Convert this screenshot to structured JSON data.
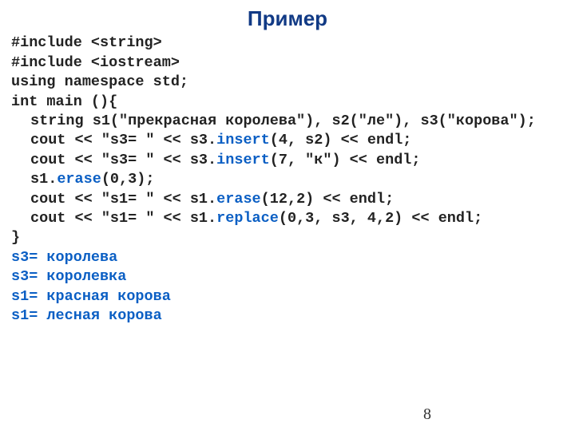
{
  "title": "Пример",
  "page_number": "8",
  "colors": {
    "heading": "#113a85",
    "code_highlight": "#0b5fc4",
    "text": "#222222",
    "background": "#ffffff"
  },
  "code": {
    "inc1": "#include <string>",
    "inc2": "#include <iostream>",
    "ns": "using namespace std;",
    "main": "int main (){",
    "decl": "string s1(\"прекрасная королева\"), s2(\"ле\"), s3(\"корова\");",
    "cout1_a": "cout << \"s3= \" << s3.",
    "cout1_m": "insert",
    "cout1_b": "(4, s2) << endl;",
    "cout2_a": "cout << \"s3= \" << s3.",
    "cout2_m": "insert",
    "cout2_b": "(7, \"к\") << endl;",
    "erase_a": "s1.",
    "erase_m": "erase",
    "erase_b": "(0,3);",
    "cout3_a": "cout << \"s1= \" << s1.",
    "cout3_m": "erase",
    "cout3_b": "(12,2) << endl;",
    "cout4_a": "cout << \"s1= \" << s1.",
    "cout4_m": "replace",
    "cout4_b": "(0,3, s3, 4,2) << endl;",
    "end": "}"
  },
  "output": {
    "o1": "s3= королева",
    "o2": "s3= королевка",
    "o3": "s1= красная корова",
    "o4": "s1= лесная корова"
  }
}
